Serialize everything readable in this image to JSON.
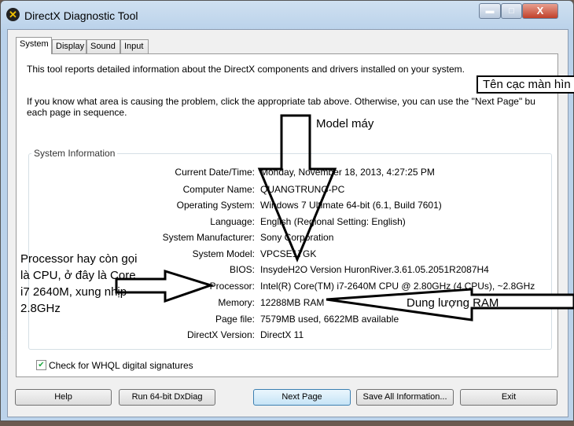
{
  "window": {
    "title": "DirectX Diagnostic Tool",
    "minimize": "▬",
    "maximize": "□",
    "close": "X"
  },
  "tabs": [
    "System",
    "Display",
    "Sound",
    "Input"
  ],
  "intro1": "This tool reports detailed information about the DirectX components and drivers installed on your system.",
  "intro2a": "If you know what area is causing the problem, click the appropriate tab above.  Otherwise, you can use the \"Next Page\" bu",
  "intro2b": "each page in sequence.",
  "group_title": "System Information",
  "rows": [
    {
      "k": "Current Date/Time:",
      "v": "Monday, November 18, 2013, 4:27:25 PM"
    },
    {
      "k": "Computer Name:",
      "v": "QUANGTRUNG-PC"
    },
    {
      "k": "Operating System:",
      "v": "Windows 7 Ultimate 64-bit (6.1, Build 7601)"
    },
    {
      "k": "Language:",
      "v": "English (Regional Setting: English)"
    },
    {
      "k": "System Manufacturer:",
      "v": "Sony Corporation"
    },
    {
      "k": "System Model:",
      "v": "VPCSE17GK"
    },
    {
      "k": "BIOS:",
      "v": "InsydeH2O Version HuronRiver.3.61.05.2051R2087H4"
    },
    {
      "k": "Processor:",
      "v": "Intel(R) Core(TM) i7-2640M CPU @ 2.80GHz (4 CPUs), ~2.8GHz"
    },
    {
      "k": "Memory:",
      "v": "12288MB RAM"
    },
    {
      "k": "Page file:",
      "v": "7579MB used, 6622MB available"
    },
    {
      "k": "DirectX Version:",
      "v": "DirectX 11"
    }
  ],
  "whql": {
    "label": "Check for WHQL digital signatures",
    "checked": true
  },
  "buttons": {
    "help": "Help",
    "run64": "Run 64-bit DxDiag",
    "next": "Next Page",
    "save": "Save All Information...",
    "exit": "Exit"
  },
  "annotations": {
    "display_names": "Tên cạc màn hìn",
    "model": "Model máy",
    "processor": [
      "Processor hay còn gọi",
      "là CPU, ở đây là Core",
      "i7 2640M, xung nhịp",
      "2.8GHz"
    ],
    "ram": "Dung lượng RAM"
  }
}
